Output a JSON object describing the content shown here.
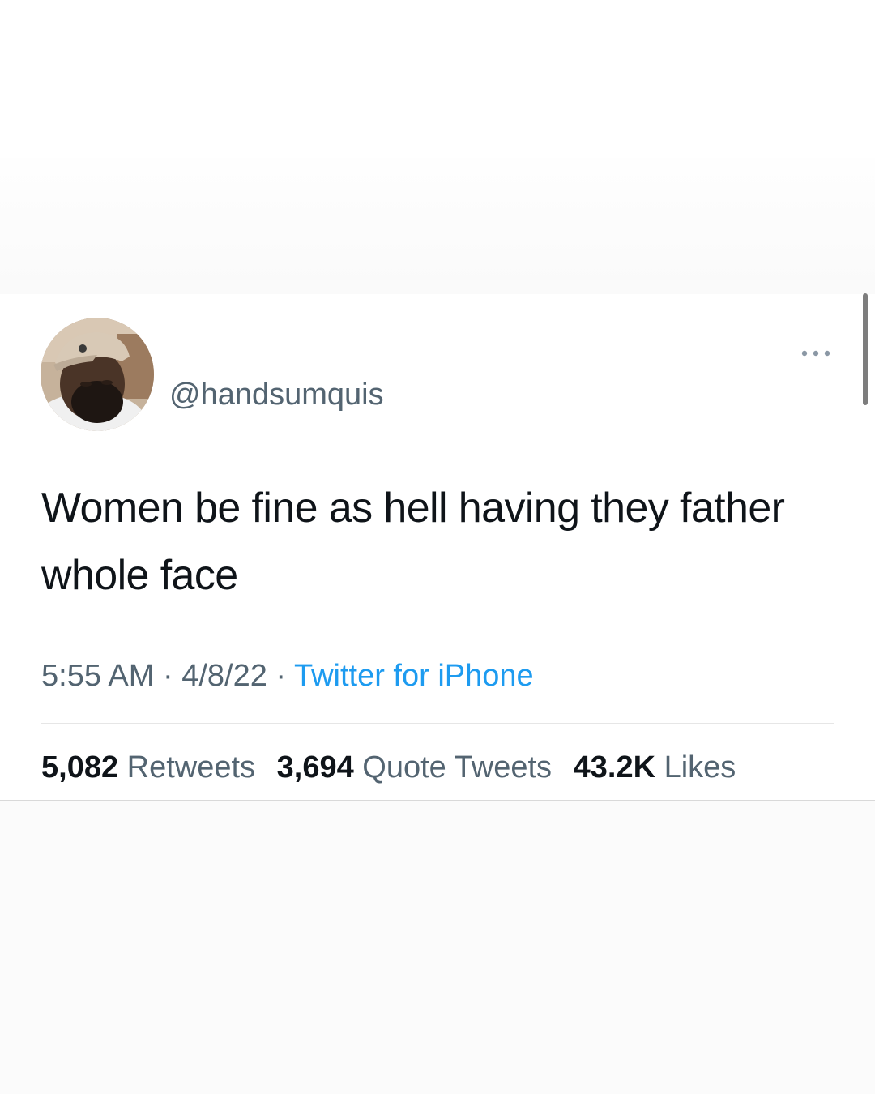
{
  "tweet": {
    "handle": "@handsumquis",
    "text": "Women be fine as hell having they father whole face",
    "time": "5:55 AM",
    "date": "4/8/22",
    "source": "Twitter for iPhone",
    "separator": "·",
    "more_icon": "more-horizontal-icon",
    "avatar_icon": "profile-photo-avatar"
  },
  "stats": {
    "retweets": {
      "count": "5,082",
      "label": "Retweets"
    },
    "quotes": {
      "count": "3,694",
      "label": "Quote Tweets"
    },
    "likes": {
      "count": "43.2K",
      "label": "Likes"
    }
  },
  "colors": {
    "text": "#0f1419",
    "secondary": "#536471",
    "link": "#1d9bf0",
    "divider": "#e6e6e6"
  }
}
